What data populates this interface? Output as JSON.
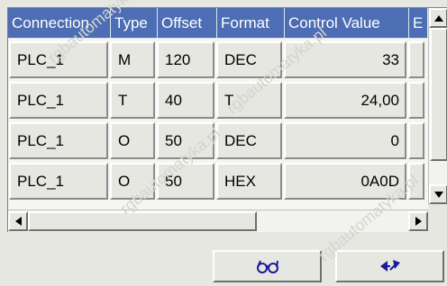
{
  "table": {
    "columns": [
      "Connection",
      "Type",
      "Offset",
      "Format",
      "Control Value",
      "E"
    ],
    "rows": [
      {
        "connection": "PLC_1",
        "type": "M",
        "offset": "120",
        "format": "DEC",
        "control_value": "33"
      },
      {
        "connection": "PLC_1",
        "type": "T",
        "offset": "40",
        "format": "T",
        "control_value": "24,00"
      },
      {
        "connection": "PLC_1",
        "type": "O",
        "offset": "50",
        "format": "DEC",
        "control_value": "0"
      },
      {
        "connection": "PLC_1",
        "type": "O",
        "offset": "50",
        "format": "HEX",
        "control_value": "0A0D"
      }
    ]
  },
  "toolbar": {
    "glasses_icon": "glasses-icon",
    "switch_icon": "switch-arrows-icon"
  },
  "scrollbar": {
    "up_icon": "arrow-up-icon",
    "down_icon": "arrow-down-icon",
    "left_icon": "arrow-left-icon",
    "right_icon": "arrow-right-icon"
  },
  "colors": {
    "header": "#4d6db4",
    "background": "#e7e7e1"
  },
  "watermark": {
    "text": "rgbautomatyka.pl"
  }
}
